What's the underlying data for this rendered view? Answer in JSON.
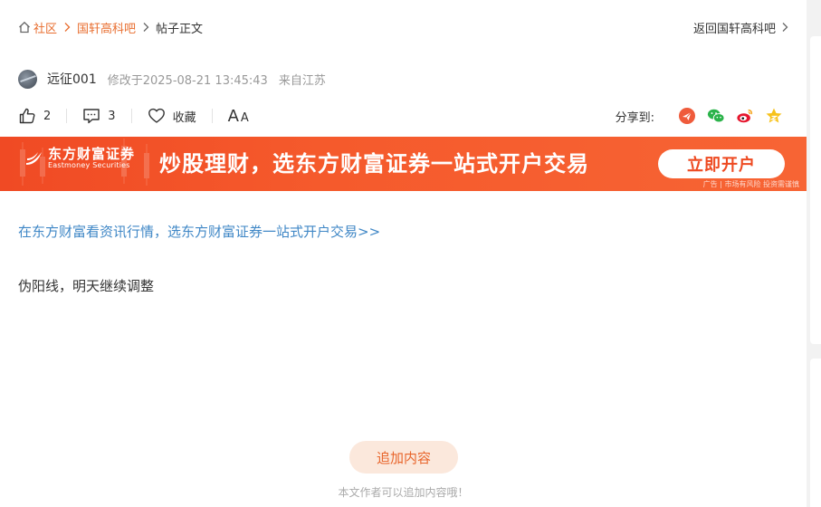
{
  "breadcrumb": {
    "home_label": "社区",
    "bar_label": "国轩高科吧",
    "current_label": "帖子正文"
  },
  "back_link": "返回国轩高科吧",
  "author": {
    "name": "远征001",
    "modified": "修改于2025-08-21 13:45:43",
    "location": "来自江苏"
  },
  "actions": {
    "like_count": "2",
    "comment_count": "3",
    "favorite_label": "收藏",
    "font_big": "A",
    "font_small": "A"
  },
  "share": {
    "label": "分享到:",
    "icons": [
      "share-red-icon",
      "wechat-icon",
      "weibo-icon",
      "star-icon"
    ]
  },
  "banner": {
    "brand_name": "东方财富证券",
    "brand_en": "Eastmoney Securities",
    "slogan": "炒股理财，选东方财富证券一站式开户交易",
    "button_label": "立即开户",
    "disclaimer": "广告 | 市场有风险 投资需谨慎"
  },
  "promo_link": "在东方财富看资讯行情，选东方财富证券一站式开户交易>>",
  "post_text": "伪阳线，明天继续调整",
  "append": {
    "button_label": "追加内容",
    "tip": "本文作者可以追加内容哦！"
  },
  "colors": {
    "accent": "#e86d2e",
    "link": "#3f87c6",
    "banner": "#f04a24"
  }
}
